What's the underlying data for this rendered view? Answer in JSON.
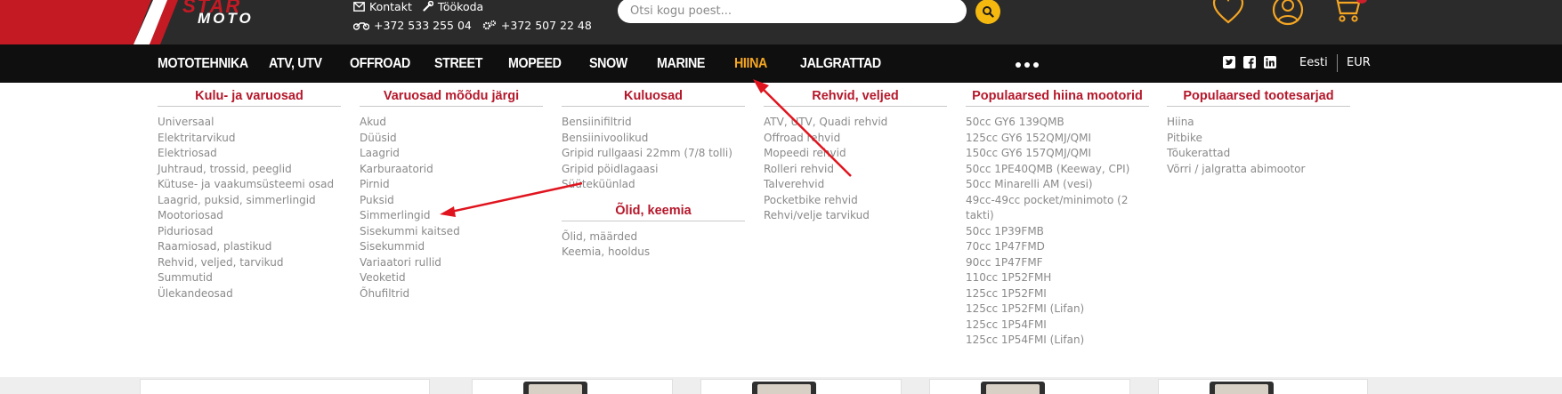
{
  "header": {
    "brand_logo_text": "STAR MOTO",
    "contact_label": "Kontakt",
    "workshop_label": "Töökoda",
    "phone_1": "+372 533 255 04",
    "phone_2": "+372 507 22 48",
    "search_placeholder": "Otsi kogu poest...",
    "icons": [
      "envelope-icon",
      "wrench-icon",
      "motorcycle-icon",
      "gears-icon",
      "search-icon",
      "heart-icon",
      "user-icon",
      "cart-icon"
    ]
  },
  "nav": {
    "items": [
      "MOTOTEHNIKA",
      "ATV, UTV",
      "OFFROAD",
      "STREET",
      "MOPEED",
      "SNOW",
      "MARINE",
      "HIINA",
      "JALGRATTAD"
    ],
    "active": "HIINA",
    "more_icon": "more-dots-icon",
    "social": [
      "twitter-icon",
      "facebook-icon",
      "linkedin-icon"
    ],
    "language": "Eesti",
    "currency": "EUR"
  },
  "menu": {
    "col1": {
      "title": "Kulu- ja varuosad",
      "items": [
        "Universaal",
        "Elektritarvikud",
        "Elektriosad",
        "Juhtraud, trossid, peeglid",
        "Kütuse- ja vaakumsüsteemi osad",
        "Laagrid, puksid, simmerlingid",
        "Mootoriosad",
        "Piduriosad",
        "Raamiosad, plastikud",
        "Rehvid, veljed, tarvikud",
        "Summutid",
        "Ülekandeosad"
      ]
    },
    "col2": {
      "title": "Varuosad mõõdu järgi",
      "items": [
        "Akud",
        "Düüsid",
        "Laagrid",
        "Karburaatorid",
        "Pirnid",
        "Puksid",
        "Simmerlingid",
        "Sisekummi kaitsed",
        "Sisekummid",
        "Variaatori rullid",
        "Veoketid",
        "Õhufiltrid"
      ]
    },
    "col3": {
      "title": "Kuluosad",
      "items": [
        "Bensiinifiltrid",
        "Bensiinivoolikud",
        "Gripid rullgaasi 22mm (7/8 tolli)",
        "Gripid pöidlagaasi",
        "Süüteküünlad"
      ],
      "sub_title": "Õlid, keemia",
      "sub_items": [
        "Õlid, määrded",
        "Keemia, hooldus"
      ]
    },
    "col4": {
      "title": "Rehvid, veljed",
      "items": [
        "ATV, UTV, Quadi rehvid",
        "Offroad rehvid",
        "Mopeedi rehvid",
        "Rolleri rehvid",
        "Talverehvid",
        "Pocketbike rehvid",
        "Rehvi/velje tarvikud"
      ]
    },
    "col5": {
      "title": "Populaarsed hiina mootorid",
      "items": [
        "50cc GY6 139QMB",
        "125cc GY6 152QMJ/QMI",
        "150cc GY6 157QMJ/QMI",
        "50cc 1PE40QMB (Keeway, CPI)",
        "50cc Minarelli AM (vesi)",
        "49cc-49cc pocket/minimoto (2 takti)",
        "50cc 1P39FMB",
        "70cc 1P47FMD",
        "90cc 1P47FMF",
        "110cc 1P52FMH",
        "125cc 1P52FMI",
        "125cc 1P52FMI (Lifan)",
        "125cc 1P54FMI",
        "125cc 1P54FMI (Lifan)"
      ]
    },
    "col6": {
      "title": "Populaarsed tootesarjad",
      "items": [
        "Hiina",
        "Pitbike",
        "Tõukerattad",
        "Võrri / jalgratta abimootor"
      ]
    }
  },
  "colors": {
    "header_bg": "#2b2b2b",
    "nav_bg": "#0f0f0f",
    "accent_red": "#b5182b",
    "active_nav": "#f5a623",
    "search_button": "#f5b80f",
    "annotation_arrow": "#e0141e"
  }
}
